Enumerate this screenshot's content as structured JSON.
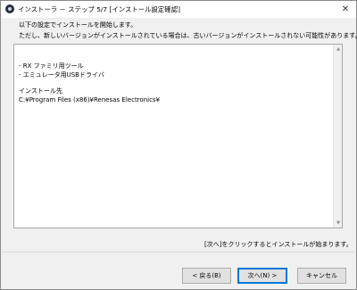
{
  "window": {
    "title": "インストーラ － ステップ 5/7 [インストール設定確認]"
  },
  "header": {
    "line1": "以下の設定でインストールを開始します。",
    "line2": "ただし、新しいバージョンがインストールされている場合は、古いバージョンがインストールされない可能性があります。"
  },
  "summary": {
    "lines": [
      "- RX ファミリ用ツール",
      "- エミュレータ用USBドライバ",
      "",
      "インストール先",
      "C:¥Program Files (x86)¥Renesas Electronics¥"
    ]
  },
  "footer_note": "[次へ]をクリックするとインストールが始まります。",
  "buttons": {
    "back": "< 戻る(B)",
    "next": "次へ(N) >",
    "cancel": "キャンセル"
  },
  "icons": {
    "close": "close-icon",
    "app": "app-icon",
    "scroll_up": "scroll-up-icon",
    "scroll_down": "scroll-down-icon"
  }
}
